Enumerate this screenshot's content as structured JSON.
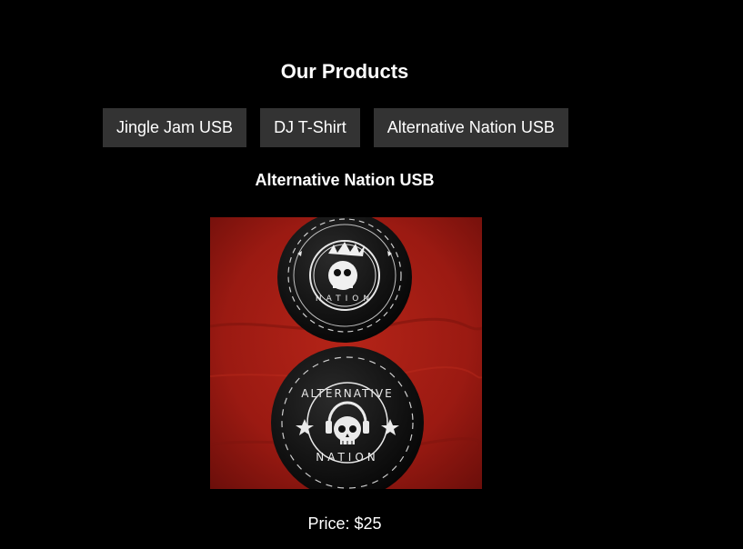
{
  "page": {
    "title": "Our Products"
  },
  "nav": {
    "products": [
      "Jingle Jam USB",
      "DJ T-Shirt",
      "Alternative Nation USB"
    ]
  },
  "product": {
    "name": "Alternative Nation USB",
    "image": {
      "subject": "two black round badges on red fabric",
      "badge_text": [
        "ALTERNATIVE",
        "NATION"
      ]
    },
    "price": "Price: $25"
  },
  "colors": {
    "background": "#000000",
    "button_background": "#333333",
    "text": "#ffffff",
    "fabric_red": "#9b1a12"
  }
}
